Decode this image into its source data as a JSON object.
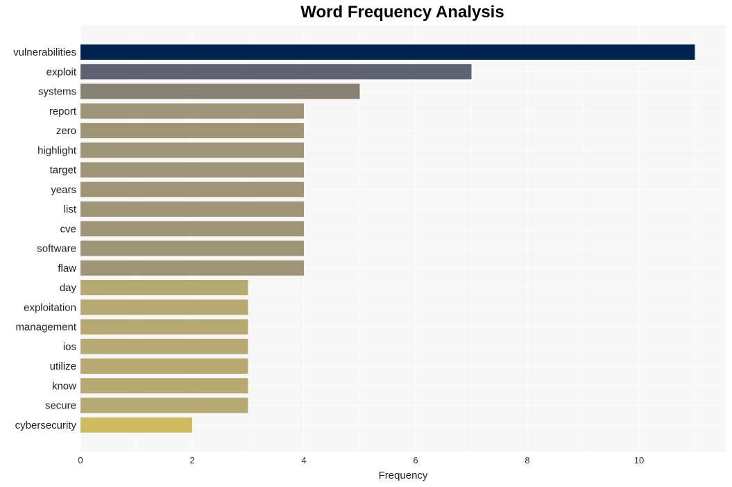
{
  "chart_data": {
    "type": "bar",
    "orientation": "horizontal",
    "title": "Word Frequency Analysis",
    "xlabel": "Frequency",
    "ylabel": "",
    "xlim": [
      0,
      11.5
    ],
    "xticks": [
      0,
      2,
      4,
      6,
      8,
      10
    ],
    "grid": true,
    "categories": [
      "vulnerabilities",
      "exploit",
      "systems",
      "report",
      "zero",
      "highlight",
      "target",
      "years",
      "list",
      "cve",
      "software",
      "flaw",
      "day",
      "exploitation",
      "management",
      "ios",
      "utilize",
      "know",
      "secure",
      "cybersecurity"
    ],
    "values": [
      11,
      7,
      5,
      4,
      4,
      4,
      4,
      4,
      4,
      4,
      4,
      4,
      3,
      3,
      3,
      3,
      3,
      3,
      3,
      2
    ],
    "colors": [
      "#00224e",
      "#5f6270",
      "#878374",
      "#9e9676",
      "#9e9676",
      "#9e9676",
      "#9e9676",
      "#9e9676",
      "#9e9676",
      "#9e9676",
      "#9e9676",
      "#9e9676",
      "#b6a971",
      "#b6a971",
      "#b6a971",
      "#b6a971",
      "#b6a971",
      "#b6a971",
      "#b6a971",
      "#cfbc60"
    ]
  }
}
